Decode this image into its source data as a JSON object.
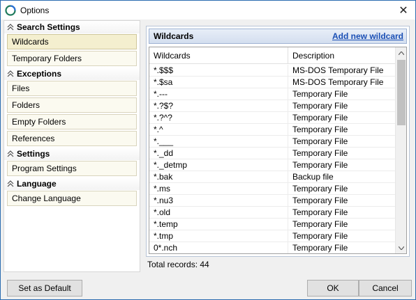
{
  "window": {
    "title": "Options"
  },
  "left": {
    "sections": [
      {
        "header": "Search Settings",
        "items": [
          {
            "label": "Wildcards",
            "active": true
          },
          {
            "label": "Temporary Folders"
          }
        ]
      },
      {
        "header": "Exceptions",
        "items": [
          {
            "label": "Files"
          },
          {
            "label": "Folders"
          },
          {
            "label": "Empty Folders"
          },
          {
            "label": "References"
          }
        ]
      },
      {
        "header": "Settings",
        "items": [
          {
            "label": "Program Settings"
          }
        ]
      },
      {
        "header": "Language",
        "items": [
          {
            "label": "Change Language"
          }
        ]
      }
    ]
  },
  "grid": {
    "title": "Wildcards",
    "add_link": "Add new wildcard",
    "columns": [
      "Wildcards",
      "Description"
    ],
    "rows": [
      [
        "*.$$$",
        "MS-DOS Temporary File"
      ],
      [
        "*.$sa",
        "MS-DOS Temporary File"
      ],
      [
        "*.---",
        "Temporary File"
      ],
      [
        "*.?$?",
        "Temporary File"
      ],
      [
        "*.?^?",
        "Temporary File"
      ],
      [
        "*.^",
        "Temporary File"
      ],
      [
        "*.___",
        "Temporary File"
      ],
      [
        "*._dd",
        "Temporary File"
      ],
      [
        "*._detmp",
        "Temporary File"
      ],
      [
        "*.bak",
        "Backup file"
      ],
      [
        "*.ms",
        "Temporary File"
      ],
      [
        "*.nu3",
        "Temporary File"
      ],
      [
        "*.old",
        "Temporary File"
      ],
      [
        "*.temp",
        "Temporary File"
      ],
      [
        "*.tmp",
        "Temporary File"
      ],
      [
        "0*.nch",
        "Temporary File"
      ]
    ],
    "total": "Total records: 44"
  },
  "buttons": {
    "default": "Set as Default",
    "ok": "OK",
    "cancel": "Cancel"
  },
  "icons": {
    "close": "close-icon",
    "app": "app-icon",
    "collapse": "chevron-up-icon"
  }
}
